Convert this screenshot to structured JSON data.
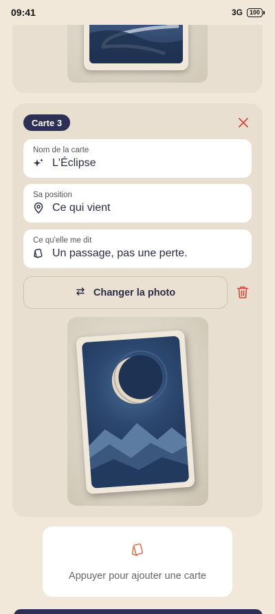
{
  "status": {
    "time": "09:41",
    "network": "3G",
    "battery": "100"
  },
  "editor": {
    "badge": "Carte 3",
    "fields": [
      {
        "label": "Nom de la carte",
        "value": "L'Éclipse",
        "icon": "sparkles-icon"
      },
      {
        "label": "Sa position",
        "value": "Ce qui vient",
        "icon": "map-pin-icon"
      },
      {
        "label": "Ce qu'elle me dit",
        "value": "Un passage, pas une perte.",
        "icon": "cards-icon"
      }
    ],
    "change_photo_label": "Changer la photo"
  },
  "add_card": {
    "label": "Appuyer pour ajouter une carte"
  },
  "colors": {
    "accent": "#2e2f55",
    "danger": "#d6473b",
    "background": "#f1e8da",
    "panel": "#e9dfd0",
    "add_icon": "#d97757"
  }
}
